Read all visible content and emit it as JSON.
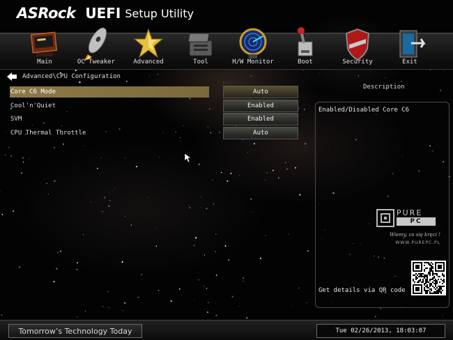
{
  "brand": {
    "asrock": "ASRock",
    "uefi": "UEFI",
    "setup": "Setup Utility"
  },
  "nav": {
    "items": [
      {
        "label": "Main",
        "icon": "main-icon"
      },
      {
        "label": "OC Tweaker",
        "icon": "rocket-icon"
      },
      {
        "label": "Advanced",
        "icon": "star-icon"
      },
      {
        "label": "Tool",
        "icon": "toolbox-icon"
      },
      {
        "label": "H/W Monitor",
        "icon": "radar-icon"
      },
      {
        "label": "Boot",
        "icon": "power-lever-icon"
      },
      {
        "label": "Security",
        "icon": "shield-icon"
      },
      {
        "label": "Exit",
        "icon": "exit-door-icon"
      }
    ],
    "active": "Advanced"
  },
  "breadcrumb": "Advanced\\CPU Configuration",
  "settings": [
    {
      "label": "Core C6 Mode",
      "value": "Auto",
      "selected": true
    },
    {
      "label": "Cool'n'Quiet",
      "value": "Enabled",
      "selected": false
    },
    {
      "label": "SVM",
      "value": "Enabled",
      "selected": false
    },
    {
      "label": "CPU Thermal Throttle",
      "value": "Auto",
      "selected": false
    }
  ],
  "description": {
    "title": "Description",
    "text": "Enabled/Disabled Core C6",
    "qr_text": "Get details via QR code"
  },
  "watermark": {
    "line1": "PURE",
    "line2": "PC",
    "line3": "Wiemy, co się kręci !",
    "line4": "WWW.PUREPC.PL"
  },
  "footer": {
    "tagline": "Tomorrow’s Technology Today",
    "datetime": "Tue 02/26/2013, 18:03:07"
  },
  "colors": {
    "selection": "#8e7a45",
    "background": "#030304"
  }
}
